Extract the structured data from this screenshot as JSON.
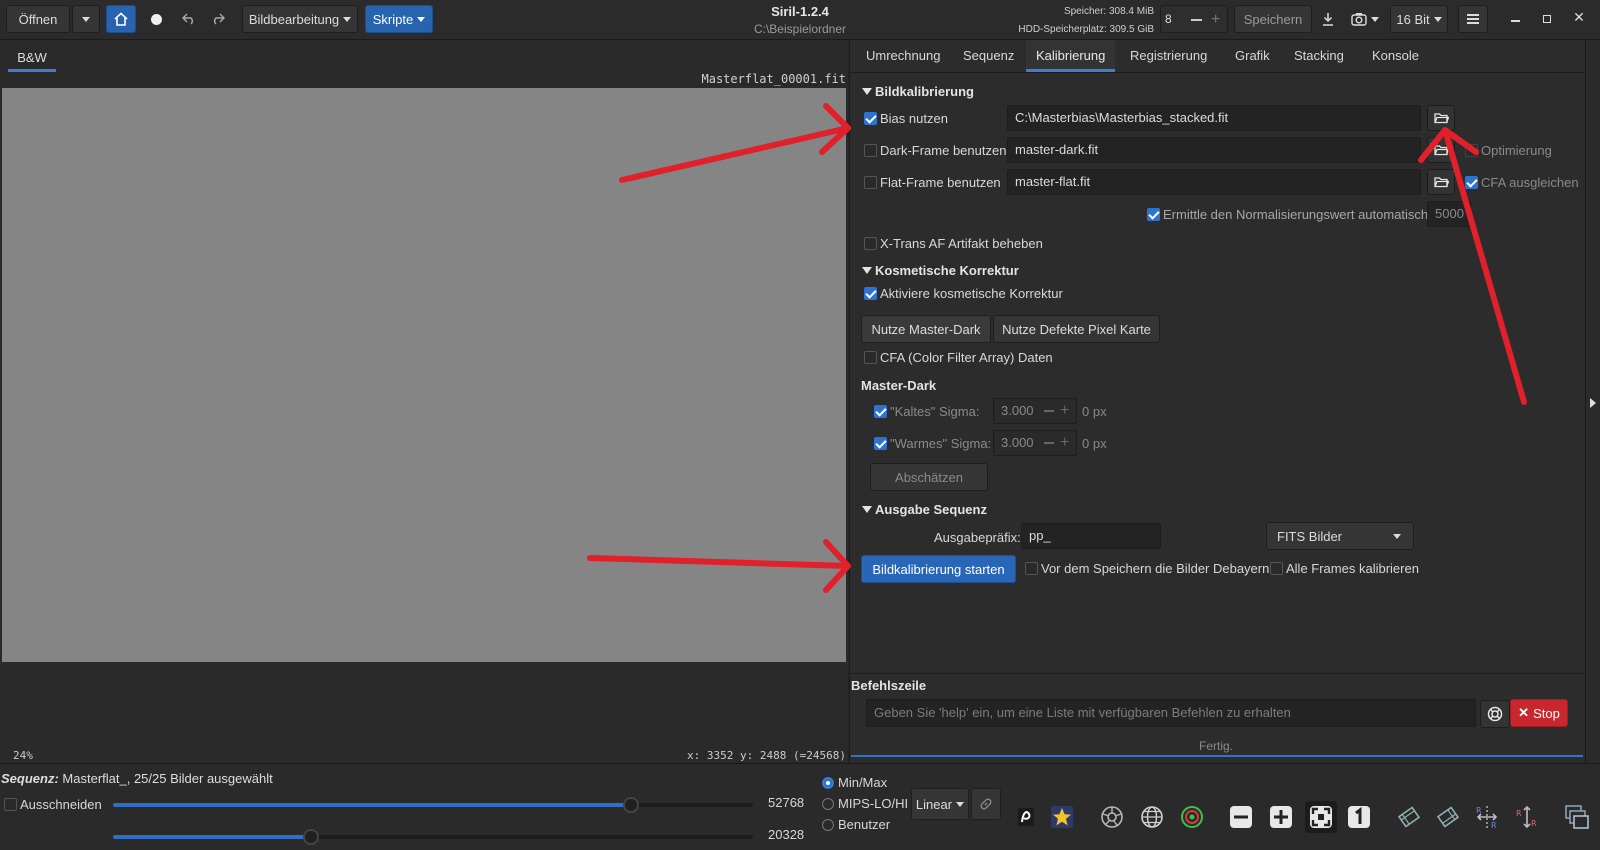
{
  "toolbar": {
    "open_label": "Öffnen",
    "image_processing_label": "Bildbearbeitung",
    "scripts_label": "Skripte",
    "app_title": "Siril-1.2.4",
    "working_dir": "C:\\Beispielordner",
    "memory_label": "Speicher: 308.4 MiB",
    "disk_label": "HDD-Speicherplatz: 309.5 GiB",
    "threads_value": "8",
    "save_label": "Speichern",
    "bitdepth_label": "16 Bit"
  },
  "left": {
    "tab_label": "B&W",
    "filename": "Masterflat_00001.fit",
    "zoom_label": "24%",
    "coords_label": "x: 3352 y: 2488 (=24568)"
  },
  "tabs": [
    "Umrechnung",
    "Sequenz",
    "Kalibrierung",
    "Registrierung",
    "Grafik",
    "Stacking",
    "Konsole"
  ],
  "active_tab": "Kalibrierung",
  "calibration": {
    "section_title": "Bildkalibrierung",
    "bias_label": "Bias nutzen",
    "bias_path": "C:\\Masterbias\\Masterbias_stacked.fit",
    "dark_label": "Dark-Frame benutzen",
    "dark_path": "master-dark.fit",
    "optimize_label": "Optimierung",
    "flat_label": "Flat-Frame benutzen",
    "flat_path": "master-flat.fit",
    "cfa_equalize_label": "CFA ausgleichen",
    "auto_norm_label": "Ermittle den Normalisierungswert automatisch",
    "norm_value": "5000",
    "xtrans_label": "X-Trans AF Artifakt beheben"
  },
  "cosmetic": {
    "section_title": "Kosmetische Korrektur",
    "activate_label": "Aktiviere kosmetische Korrektur",
    "use_master_dark_label": "Nutze Master-Dark",
    "use_bad_pixel_map_label": "Nutze Defekte Pixel Karte",
    "cfa_data_label": "CFA (Color Filter Array) Daten",
    "master_dark_title": "Master-Dark",
    "cold_sigma_label": "\"Kaltes\" Sigma:",
    "cold_sigma_value": "3.000",
    "cold_px_label": "0 px",
    "hot_sigma_label": "\"Warmes\" Sigma:",
    "hot_sigma_value": "3.000",
    "hot_px_label": "0 px",
    "estimate_label": "Abschätzen"
  },
  "output": {
    "section_title": "Ausgabe Sequenz",
    "prefix_label": "Ausgabepräfix:",
    "prefix_value": "pp_",
    "format_value": "FITS Bilder",
    "start_label": "Bildkalibrierung starten",
    "debayer_label": "Vor dem Speichern die Bilder Debayern",
    "all_frames_label": "Alle Frames kalibrieren"
  },
  "command": {
    "title": "Befehlszeile",
    "placeholder": "Geben Sie 'help' ein, um eine Liste mit verfügbaren Befehlen zu erhalten",
    "stop_label": "Stop",
    "status": "Fertig."
  },
  "bottom": {
    "sequence_prefix": "Sequenz:",
    "sequence_text": "Masterflat_, 25/25 Bilder ausgewählt",
    "crop_label": "Ausschneiden",
    "high_value": "52768",
    "low_value": "20328",
    "high_fraction": 0.81,
    "low_fraction": 0.31,
    "radio_minmax": "Min/Max",
    "radio_mips": "MIPS-LO/HI",
    "radio_user": "Benutzer",
    "stretch_label": "Linear"
  },
  "colors": {
    "accent": "#2f73d0",
    "stop": "#c8282d",
    "annotation_arrow": "#e0202a"
  }
}
